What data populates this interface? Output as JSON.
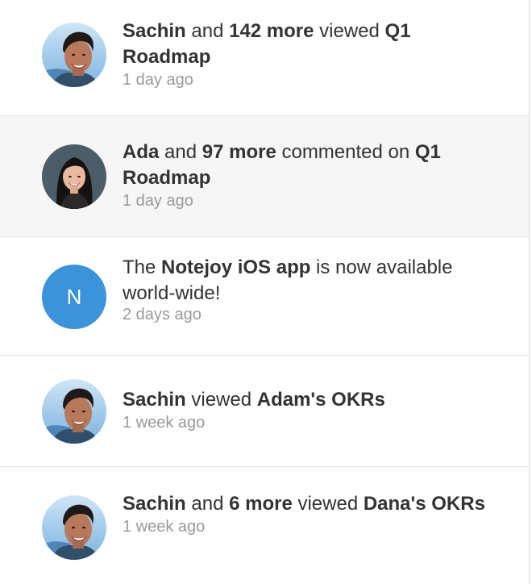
{
  "feed": {
    "items": [
      {
        "actor": "Sachin",
        "connector": " and ",
        "count": "142 more",
        "verb": " viewed ",
        "target": "Q1 Roadmap",
        "time": "1 day ago",
        "avatar": "sachin-photo"
      },
      {
        "actor": "Ada",
        "connector": " and ",
        "count": "97 more",
        "verb": " commented on ",
        "target": "Q1 Roadmap",
        "time": "1 day ago",
        "avatar": "ada-photo"
      },
      {
        "prefix": "The ",
        "highlight": "Notejoy iOS app",
        "suffix": " is now available world-wide!",
        "time": "2 days ago",
        "avatar_letter": "N",
        "avatar_color": "#3b93d9"
      },
      {
        "actor": "Sachin",
        "verb": " viewed ",
        "target": "Adam's OKRs",
        "time": "1 week ago",
        "avatar": "sachin-photo"
      },
      {
        "actor": "Sachin",
        "connector": " and ",
        "count": "6 more",
        "verb": " viewed ",
        "target": "Dana's OKRs",
        "time": "1 week ago",
        "avatar": "sachin-photo"
      }
    ]
  }
}
